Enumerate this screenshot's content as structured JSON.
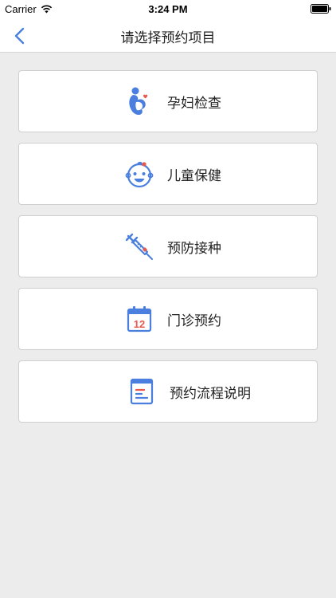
{
  "status_bar": {
    "carrier": "Carrier",
    "time": "3:24 PM",
    "wifi_icon": "wifi-icon",
    "battery_icon": "battery-icon"
  },
  "nav": {
    "title": "请选择预约项目",
    "back_icon": "chevron-left-icon"
  },
  "menu": {
    "items": [
      {
        "label": "孕妇检查",
        "icon": "pregnant-woman-icon"
      },
      {
        "label": "儿童保健",
        "icon": "baby-face-icon"
      },
      {
        "label": "预防接种",
        "icon": "syringe-icon"
      },
      {
        "label": "门诊预约",
        "icon": "calendar-icon",
        "icon_text": "12"
      },
      {
        "label": "预约流程说明",
        "icon": "document-icon"
      }
    ]
  },
  "colors": {
    "accent": "#4a7fe0",
    "highlight": "#e8584f",
    "background": "#ececec"
  }
}
